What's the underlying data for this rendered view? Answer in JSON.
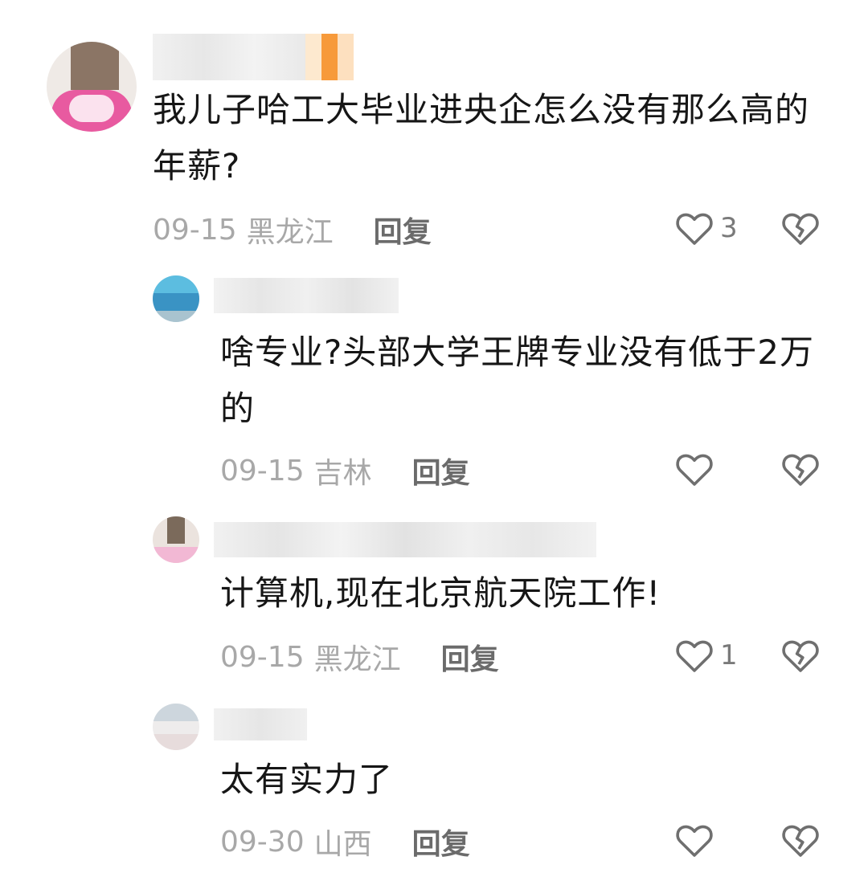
{
  "comments": [
    {
      "text": "我儿子哈工大毕业进央企怎么没有那么高的年薪?",
      "date": "09-15",
      "region": "黑龙江",
      "reply": "回复",
      "likes": "3"
    },
    {
      "text": "啥专业?头部大学王牌专业没有低于2万的",
      "date": "09-15",
      "region": "吉林",
      "reply": "回复",
      "likes": ""
    },
    {
      "text": "计算机,现在北京航天院工作!",
      "date": "09-15",
      "region": "黑龙江",
      "reply": "回复",
      "likes": "1"
    },
    {
      "text": "太有实力了",
      "date": "09-30",
      "region": "山西",
      "reply": "回复",
      "likes": ""
    }
  ],
  "icons": {
    "like": "heart-outline-icon",
    "dislike": "broken-heart-icon"
  },
  "colors": {
    "text": "#161616",
    "meta": "#a8a8a8",
    "reply": "#6b6b6b",
    "icon": "#6f6f6f"
  }
}
